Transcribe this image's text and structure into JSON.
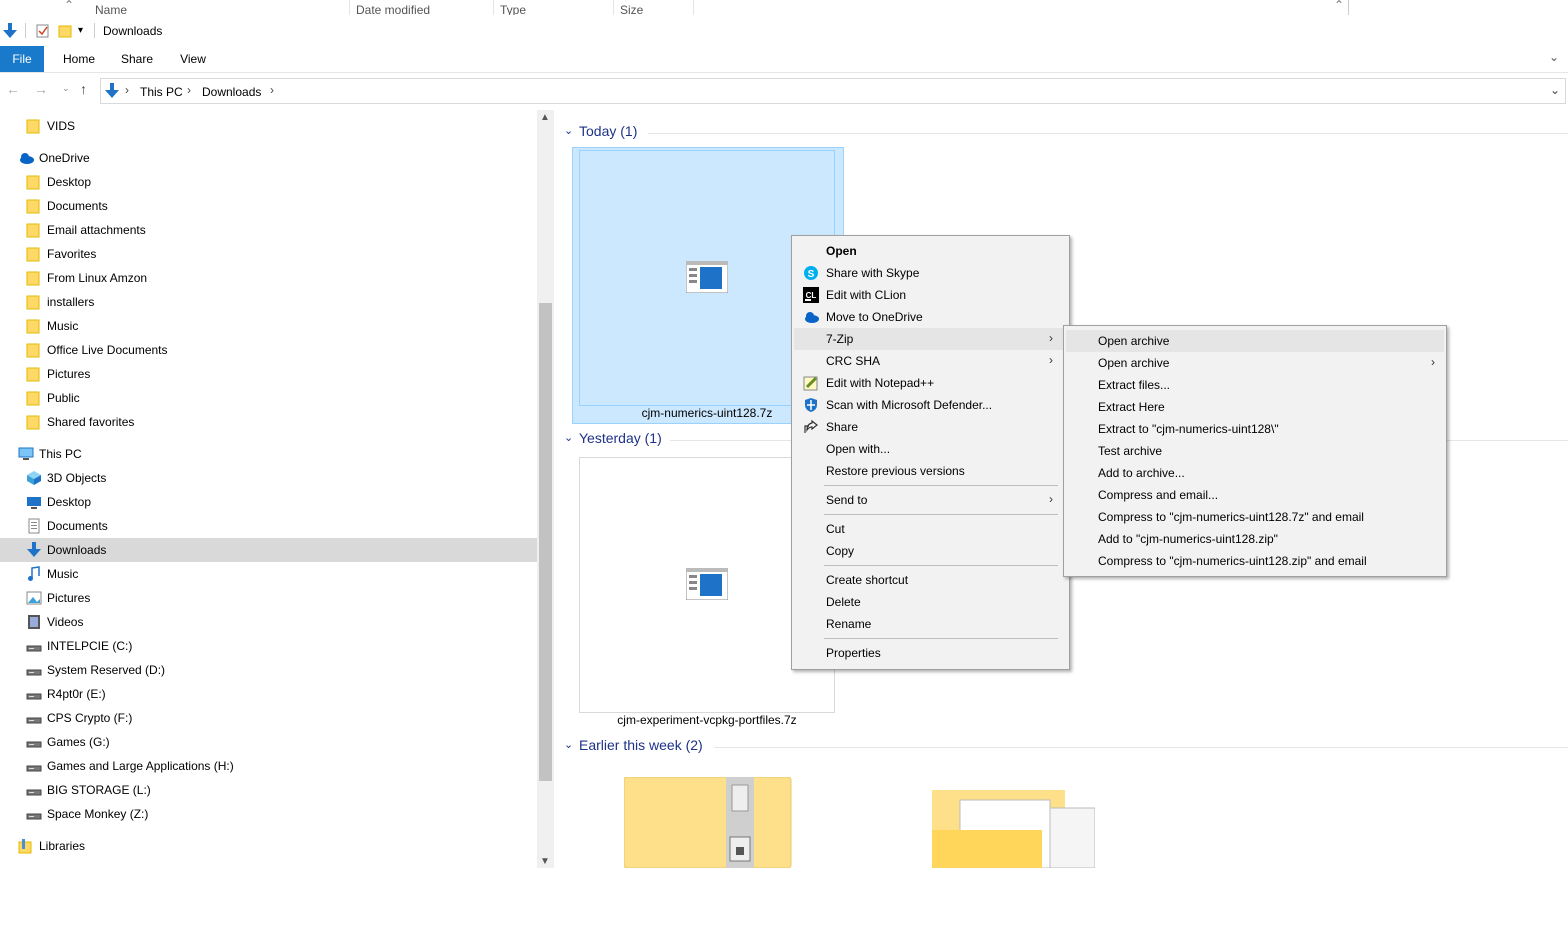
{
  "columns": [
    "Name",
    "Date modified",
    "Type",
    "Size"
  ],
  "window": {
    "title": "Downloads"
  },
  "ribbon": {
    "tabs": [
      "File",
      "Home",
      "Share",
      "View"
    ]
  },
  "address": {
    "crumbs": [
      "This PC",
      "Downloads"
    ]
  },
  "nav": {
    "items": [
      {
        "label": "VIDS",
        "icon": "folder-icon"
      },
      {
        "label": "OneDrive",
        "icon": "onedrive-icon"
      },
      {
        "label": "Desktop",
        "icon": "folder-icon"
      },
      {
        "label": "Documents",
        "icon": "folder-icon"
      },
      {
        "label": "Email attachments",
        "icon": "folder-icon"
      },
      {
        "label": "Favorites",
        "icon": "folder-icon"
      },
      {
        "label": "From Linux Amzon",
        "icon": "folder-icon"
      },
      {
        "label": "installers",
        "icon": "folder-icon"
      },
      {
        "label": "Music",
        "icon": "folder-icon"
      },
      {
        "label": "Office Live Documents",
        "icon": "folder-icon"
      },
      {
        "label": "Pictures",
        "icon": "folder-icon"
      },
      {
        "label": "Public",
        "icon": "folder-icon"
      },
      {
        "label": "Shared favorites",
        "icon": "folder-icon"
      },
      {
        "label": "This PC",
        "icon": "computer-icon"
      },
      {
        "label": "3D Objects",
        "icon": "3d-objects-icon"
      },
      {
        "label": "Desktop",
        "icon": "desktop-icon"
      },
      {
        "label": "Documents",
        "icon": "documents-icon"
      },
      {
        "label": "Downloads",
        "icon": "downloads-icon"
      },
      {
        "label": "Music",
        "icon": "music-icon"
      },
      {
        "label": "Pictures",
        "icon": "pictures-icon"
      },
      {
        "label": "Videos",
        "icon": "videos-icon"
      },
      {
        "label": "INTELPCIE (C:)",
        "icon": "drive-icon"
      },
      {
        "label": "System Reserved (D:)",
        "icon": "drive-icon"
      },
      {
        "label": "R4pt0r (E:)",
        "icon": "drive-icon"
      },
      {
        "label": "CPS Crypto (F:)",
        "icon": "drive-icon"
      },
      {
        "label": "Games (G:)",
        "icon": "drive-icon"
      },
      {
        "label": "Games and Large Applications (H:)",
        "icon": "drive-icon"
      },
      {
        "label": "BIG STORAGE (L:)",
        "icon": "drive-icon"
      },
      {
        "label": "Space Monkey (Z:)",
        "icon": "drive-icon"
      },
      {
        "label": "Libraries",
        "icon": "libraries-icon"
      }
    ]
  },
  "content": {
    "groups": [
      "Today (1)",
      "Yesterday (1)",
      "Earlier this week (2)"
    ],
    "files": [
      "cjm-numerics-uint128.7z",
      "cjm-experiment-vcpkg-portfiles.7z"
    ]
  },
  "context_menu": {
    "items": [
      "Open",
      "Share with Skype",
      "Edit with CLion",
      "Move to OneDrive",
      "7-Zip",
      "CRC SHA",
      "Edit with Notepad++",
      "Scan with Microsoft Defender...",
      "Share",
      "Open with...",
      "Restore previous versions",
      "Send to",
      "Cut",
      "Copy",
      "Create shortcut",
      "Delete",
      "Rename",
      "Properties"
    ]
  },
  "submenu": {
    "items": [
      "Open archive",
      "Open archive",
      "Extract files...",
      "Extract Here",
      "Extract to \"cjm-numerics-uint128\\\"",
      "Test archive",
      "Add to archive...",
      "Compress and email...",
      "Compress to \"cjm-numerics-uint128.7z\" and email",
      "Add to \"cjm-numerics-uint128.zip\"",
      "Compress to \"cjm-numerics-uint128.zip\" and email"
    ]
  }
}
